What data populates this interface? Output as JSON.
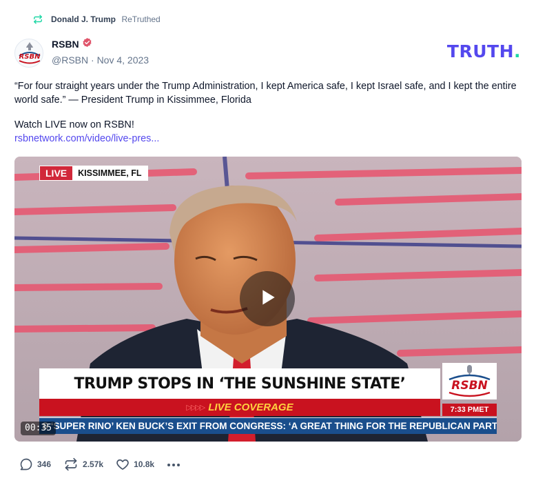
{
  "retruth": {
    "icon": "retruth-icon",
    "user": "Donald J. Trump",
    "label": "ReTruthed"
  },
  "author": {
    "avatar_text": "RSBN",
    "name": "RSBN",
    "verified": true,
    "handle": "@RSBN",
    "date": "Nov 4, 2023"
  },
  "brand": {
    "text": "TRUTH",
    "dot": ".",
    "color": "#5448ee",
    "dot_color": "#1ed7a5"
  },
  "post": {
    "text": "“For four straight years under the Trump Administration, I kept America safe, I kept Israel safe, and I kept the entire world safe.” — President Trump in Kissimmee, Florida",
    "watch": "Watch LIVE now on RSBN!",
    "link": "rsbnetwork.com/video/live-pres..."
  },
  "video": {
    "live": "LIVE",
    "location": "KISSIMMEE, FL",
    "headline": "TRUMP STOPS IN ‘THE SUNSHINE STATE’",
    "live_coverage": "LIVE COVERAGE",
    "ticker": "S ‘SUPER RINO’ KEN BUCK’S EXIT FROM CONGRESS: ‘A GREAT THING FOR THE REPUBLICAN PART",
    "logo": "RSBN",
    "time": "7:33 PMET",
    "duration": "00:35",
    "play_icon": "play-icon"
  },
  "actions": {
    "replies": "346",
    "retruths": "2.57k",
    "likes": "10.8k",
    "more_icon": "more-icon"
  },
  "colors": {
    "accent": "#5448ee",
    "text": "#0f172a",
    "muted": "#64748b",
    "verified": "#e0556b"
  }
}
